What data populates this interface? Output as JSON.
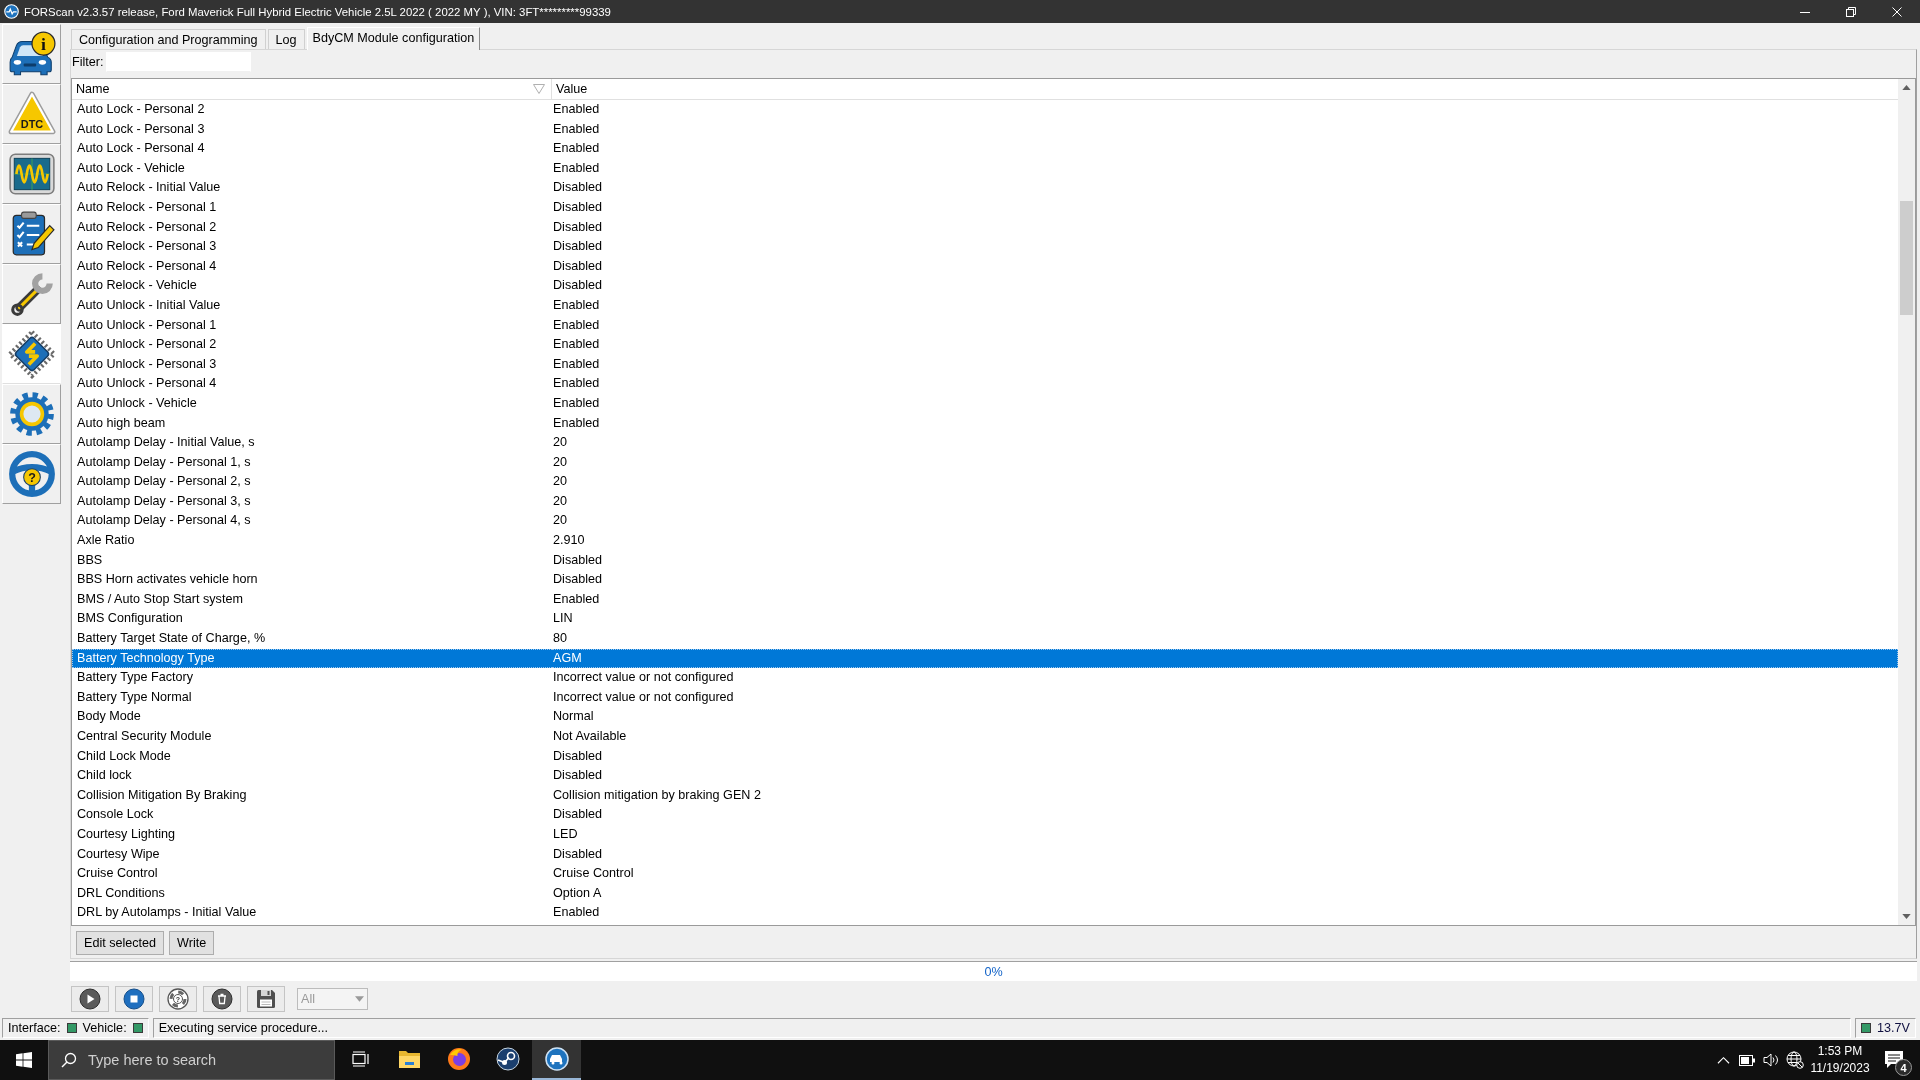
{
  "window": {
    "title": "FORScan v2.3.57 release, Ford Maverick Full Hybrid Electric Vehicle 2.5L 2022 ( 2022 MY ), VIN: 3FT*********99339"
  },
  "sidebar": {
    "items": [
      {
        "kind": "info",
        "glyph": "i",
        "selected": false
      },
      {
        "kind": "dtc",
        "glyph": "DTC",
        "selected": false
      },
      {
        "kind": "monitor",
        "selected": false
      },
      {
        "kind": "tests",
        "selected": false
      },
      {
        "kind": "service",
        "selected": false
      },
      {
        "kind": "config",
        "selected": true
      },
      {
        "kind": "settings",
        "selected": false
      },
      {
        "kind": "help",
        "glyph": "?",
        "selected": false
      }
    ]
  },
  "tabs": [
    {
      "label": "Configuration and Programming",
      "selected": false
    },
    {
      "label": "Log",
      "selected": false
    },
    {
      "label": "BdyCM Module configuration",
      "selected": true
    }
  ],
  "filter": {
    "label": "Filter:"
  },
  "table": {
    "columns": [
      {
        "label": "Name",
        "sorted": true
      },
      {
        "label": "Value",
        "sorted": false
      }
    ],
    "rows": [
      {
        "name": "Auto Lock - Personal 2",
        "value": "Enabled",
        "selected": false
      },
      {
        "name": "Auto Lock - Personal 3",
        "value": "Enabled",
        "selected": false
      },
      {
        "name": "Auto Lock - Personal 4",
        "value": "Enabled",
        "selected": false
      },
      {
        "name": "Auto Lock - Vehicle",
        "value": "Enabled",
        "selected": false
      },
      {
        "name": "Auto Relock - Initial Value",
        "value": "Disabled",
        "selected": false
      },
      {
        "name": "Auto Relock - Personal 1",
        "value": "Disabled",
        "selected": false
      },
      {
        "name": "Auto Relock - Personal 2",
        "value": "Disabled",
        "selected": false
      },
      {
        "name": "Auto Relock - Personal 3",
        "value": "Disabled",
        "selected": false
      },
      {
        "name": "Auto Relock - Personal 4",
        "value": "Disabled",
        "selected": false
      },
      {
        "name": "Auto Relock - Vehicle",
        "value": "Disabled",
        "selected": false
      },
      {
        "name": "Auto Unlock - Initial Value",
        "value": "Enabled",
        "selected": false
      },
      {
        "name": "Auto Unlock - Personal 1",
        "value": "Enabled",
        "selected": false
      },
      {
        "name": "Auto Unlock - Personal 2",
        "value": "Enabled",
        "selected": false
      },
      {
        "name": "Auto Unlock - Personal 3",
        "value": "Enabled",
        "selected": false
      },
      {
        "name": "Auto Unlock - Personal 4",
        "value": "Enabled",
        "selected": false
      },
      {
        "name": "Auto Unlock - Vehicle",
        "value": "Enabled",
        "selected": false
      },
      {
        "name": "Auto high beam",
        "value": "Enabled",
        "selected": false
      },
      {
        "name": "Autolamp Delay - Initial Value, s",
        "value": "20",
        "selected": false
      },
      {
        "name": "Autolamp Delay - Personal 1, s",
        "value": "20",
        "selected": false
      },
      {
        "name": "Autolamp Delay - Personal 2, s",
        "value": "20",
        "selected": false
      },
      {
        "name": "Autolamp Delay - Personal 3, s",
        "value": "20",
        "selected": false
      },
      {
        "name": "Autolamp Delay - Personal 4, s",
        "value": "20",
        "selected": false
      },
      {
        "name": "Axle Ratio",
        "value": "2.910",
        "selected": false
      },
      {
        "name": "BBS",
        "value": "Disabled",
        "selected": false
      },
      {
        "name": "BBS Horn activates vehicle horn",
        "value": "Disabled",
        "selected": false
      },
      {
        "name": "BMS / Auto Stop Start system",
        "value": "Enabled",
        "selected": false
      },
      {
        "name": "BMS Configuration",
        "value": "LIN",
        "selected": false
      },
      {
        "name": "Battery Target State of Charge, %",
        "value": "80",
        "selected": false
      },
      {
        "name": "Battery Technology Type",
        "value": "AGM",
        "selected": true
      },
      {
        "name": "Battery Type Factory",
        "value": "Incorrect value or not configured",
        "selected": false
      },
      {
        "name": "Battery Type Normal",
        "value": "Incorrect value or not configured",
        "selected": false
      },
      {
        "name": "Body Mode",
        "value": "Normal",
        "selected": false
      },
      {
        "name": "Central Security Module",
        "value": "Not Available",
        "selected": false
      },
      {
        "name": "Child Lock Mode",
        "value": "Disabled",
        "selected": false
      },
      {
        "name": "Child lock",
        "value": "Disabled",
        "selected": false
      },
      {
        "name": "Collision Mitigation By Braking",
        "value": "Collision mitigation by braking GEN 2",
        "selected": false
      },
      {
        "name": "Console Lock",
        "value": "Disabled",
        "selected": false
      },
      {
        "name": "Courtesy Lighting",
        "value": "LED",
        "selected": false
      },
      {
        "name": "Courtesy Wipe",
        "value": "Disabled",
        "selected": false
      },
      {
        "name": "Cruise Control",
        "value": "Cruise Control",
        "selected": false
      },
      {
        "name": "DRL Conditions",
        "value": "Option A",
        "selected": false
      },
      {
        "name": "DRL by Autolamps - Initial Value",
        "value": "Enabled",
        "selected": false
      }
    ]
  },
  "buttons": [
    "Edit selected",
    "Write"
  ],
  "progress": {
    "level": 0,
    "label": "0%"
  },
  "toolbar": {
    "buttons": [
      {
        "kind": "start"
      },
      {
        "kind": "stop"
      },
      {
        "kind": "help",
        "glyph": "?"
      },
      {
        "kind": "clear"
      },
      {
        "kind": "save"
      }
    ],
    "dropdown": {
      "value": "All",
      "disabled": true
    }
  },
  "status_bar": {
    "indicators": [
      {
        "label": "Interface:",
        "color": "#339966"
      },
      {
        "label": "Vehicle:",
        "color": "#339966"
      }
    ],
    "message": "Executing service procedure...",
    "voltage": {
      "value": "13.7V",
      "color": "#339966"
    }
  },
  "taskbar": {
    "search": {
      "placeholder": "Type here to search"
    },
    "apps": [
      {
        "kind": "task-view",
        "active": false
      },
      {
        "kind": "file-explorer",
        "active": false
      },
      {
        "kind": "browser",
        "active": false
      },
      {
        "kind": "launcher",
        "active": false
      },
      {
        "kind": "diagnostics",
        "active": true
      }
    ],
    "tray": {
      "time": "1:53 PM",
      "date": "11/19/2023",
      "notifications": "4"
    }
  }
}
